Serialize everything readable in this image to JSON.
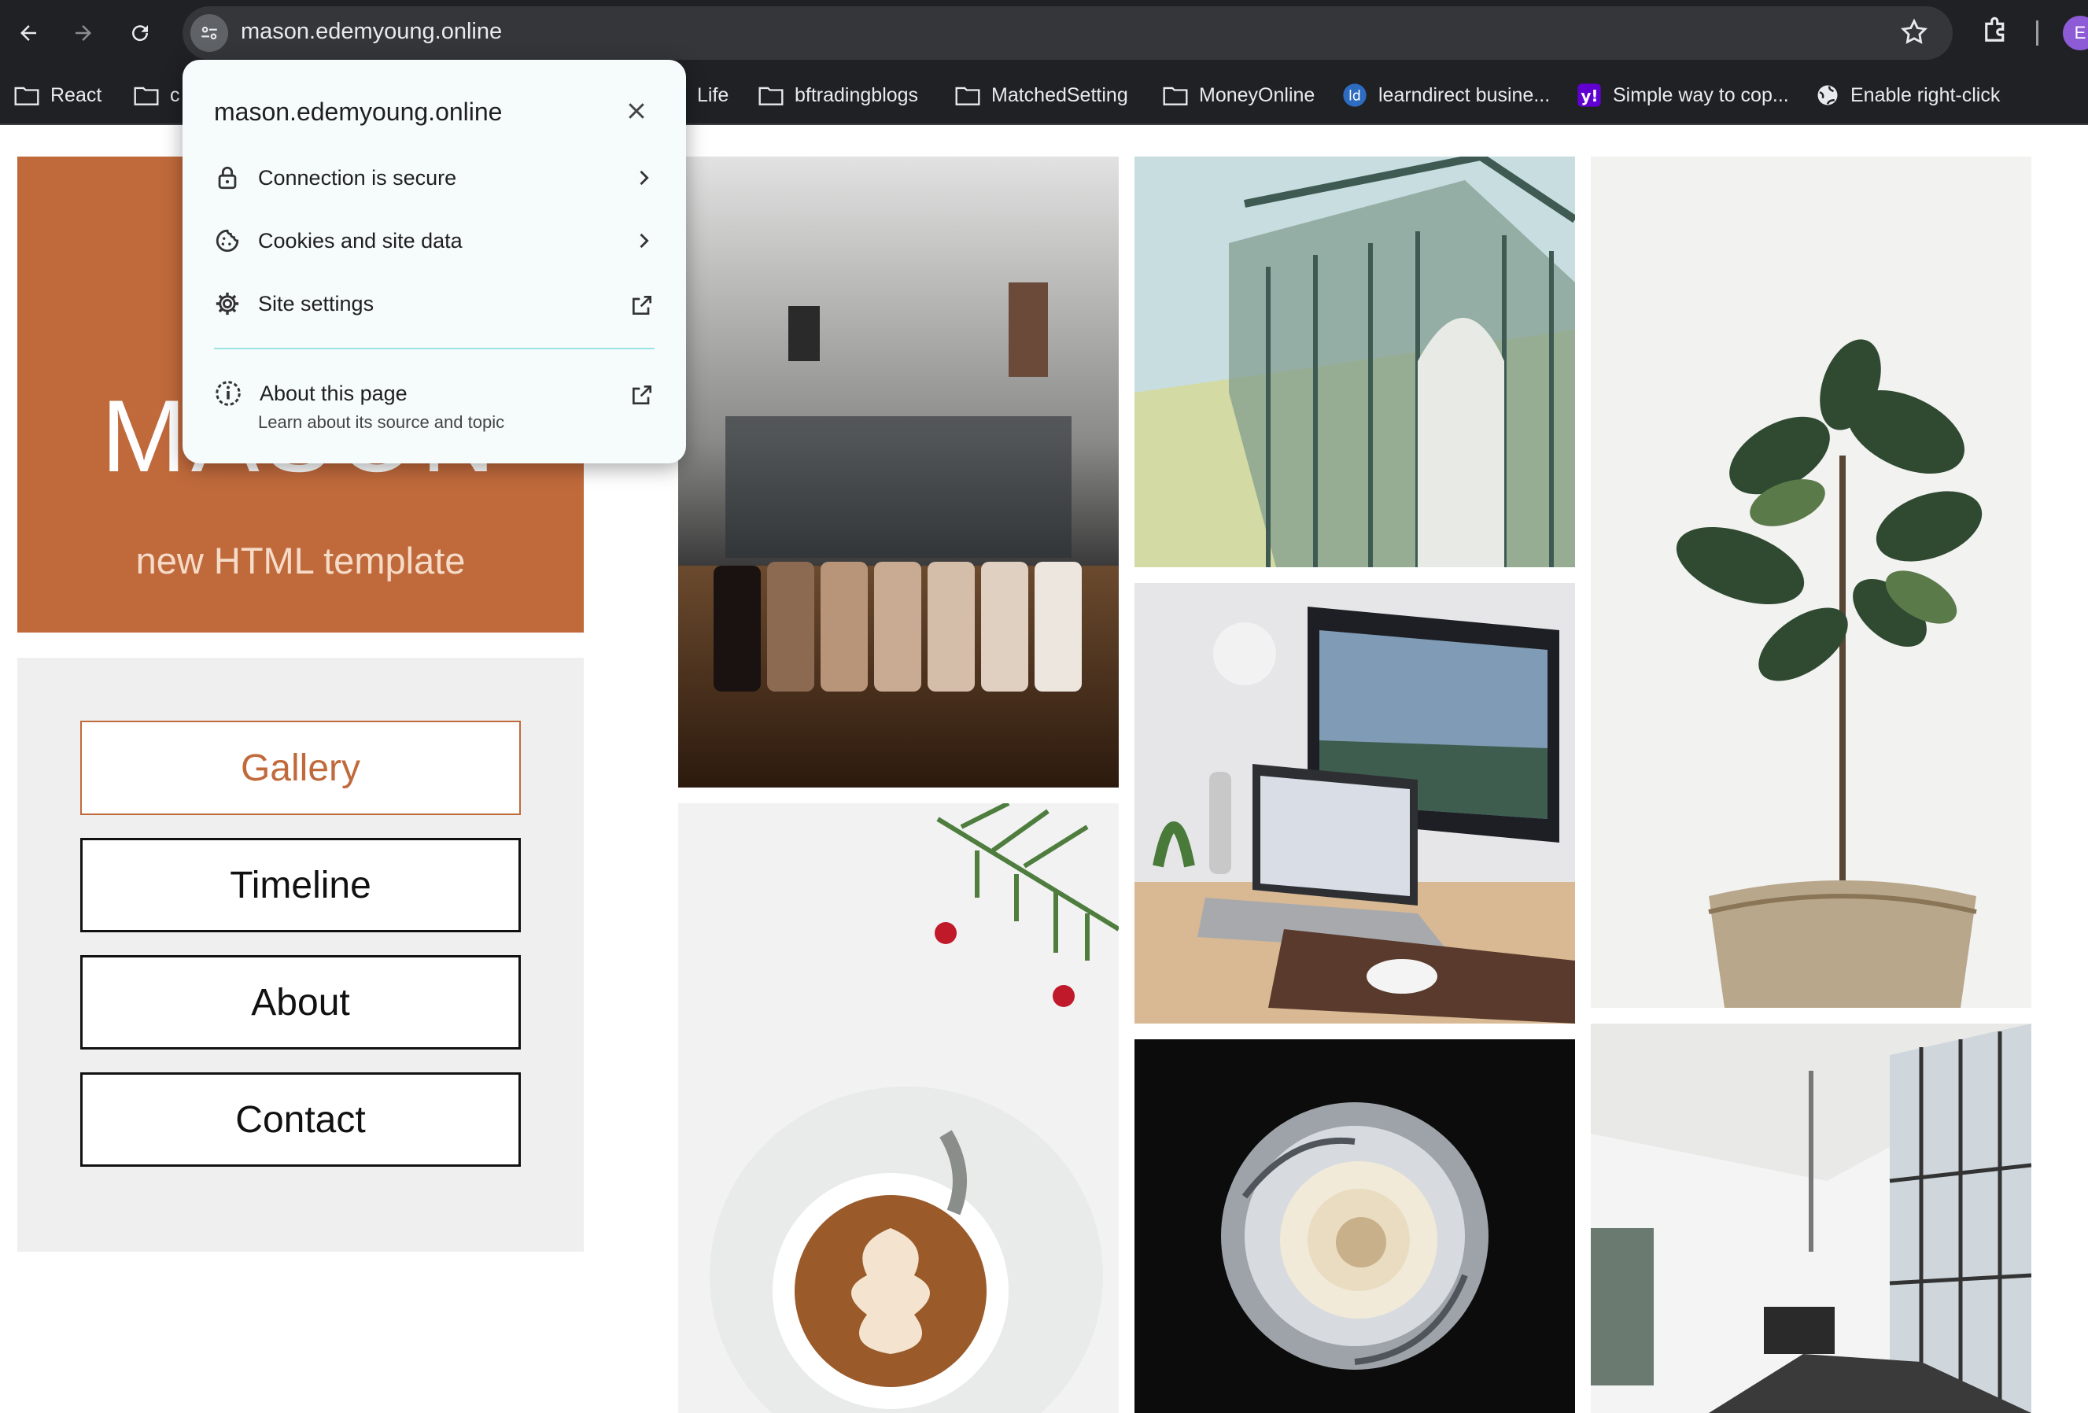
{
  "browser": {
    "url": "mason.edemyoung.online",
    "profile_initial": "E",
    "bookmarks": [
      {
        "label": "React",
        "icon": "folder-icon"
      },
      {
        "label": "c",
        "icon": "folder-icon"
      },
      {
        "label": "Life",
        "icon": "folder-icon"
      },
      {
        "label": "bftradingblogs",
        "icon": "folder-icon"
      },
      {
        "label": "MatchedSetting",
        "icon": "folder-icon"
      },
      {
        "label": "MoneyOnline",
        "icon": "folder-icon"
      },
      {
        "label": "learndirect busine...",
        "icon": "learndirect-icon"
      },
      {
        "label": "Simple way to cop...",
        "icon": "yahoo-icon"
      },
      {
        "label": "Enable right-click",
        "icon": "globe-icon"
      }
    ]
  },
  "site_info_popup": {
    "title": "mason.edemyoung.online",
    "items": [
      {
        "label": "Connection is secure",
        "icon": "lock-icon",
        "end_icon": "chevron-right-icon"
      },
      {
        "label": "Cookies and site data",
        "icon": "cookie-icon",
        "end_icon": "chevron-right-icon"
      },
      {
        "label": "Site settings",
        "icon": "gear-icon",
        "end_icon": "external-link-icon"
      }
    ],
    "about": {
      "label": "About this page",
      "sublabel": "Learn about its source and topic",
      "icon": "info-icon",
      "end_icon": "external-link-icon"
    }
  },
  "page": {
    "hero": {
      "title": "MASON",
      "subtitle": "new HTML template",
      "bg_color": "#c06a3c"
    },
    "menu": [
      {
        "label": "Gallery",
        "active": true
      },
      {
        "label": "Timeline",
        "active": false
      },
      {
        "label": "About",
        "active": false
      },
      {
        "label": "Contact",
        "active": false
      }
    ],
    "gallery": [
      {
        "name": "coffee-jars-photo"
      },
      {
        "name": "banknote-architecture-photo"
      },
      {
        "name": "fiddle-leaf-plant-photo"
      },
      {
        "name": "desk-computer-photo"
      },
      {
        "name": "latte-art-photo"
      },
      {
        "name": "white-rose-photo"
      },
      {
        "name": "office-interior-photo"
      }
    ]
  }
}
